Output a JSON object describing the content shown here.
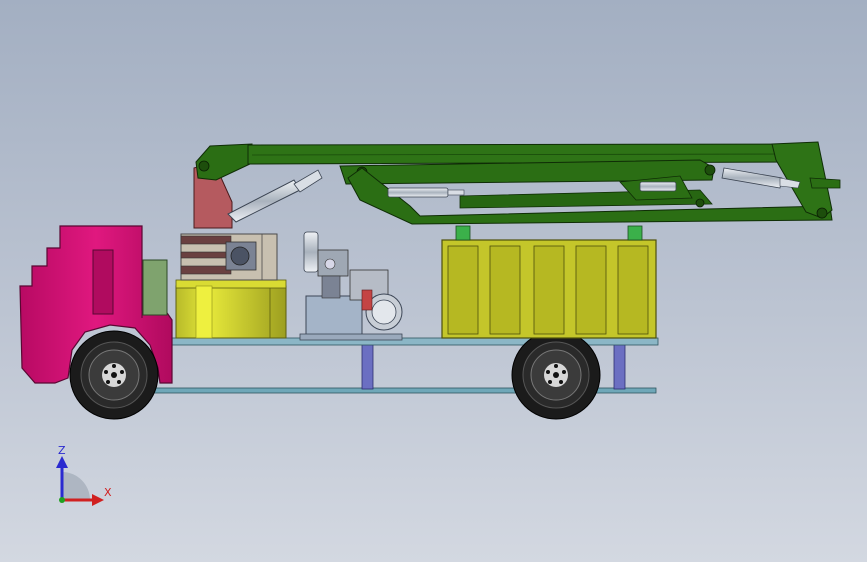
{
  "triad": {
    "z_label": "Z",
    "x_label": "X"
  },
  "colors": {
    "cab": "#d8127a",
    "boom": "#2b6e14",
    "body": "#c4c62a",
    "frame": "#8bb6c6",
    "turret": "#b55a5f",
    "cylinder": "#c0c8d2",
    "wheel": "#1b1b1b",
    "strut": "#6b6fc2",
    "z_axis": "#2a2ad0",
    "x_axis": "#d02020"
  }
}
